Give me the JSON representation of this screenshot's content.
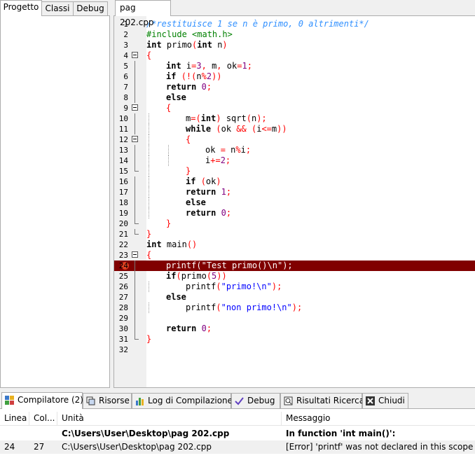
{
  "left_panel": {
    "tabs": [
      {
        "label": "Progetto",
        "active": true
      },
      {
        "label": "Classi",
        "active": false
      },
      {
        "label": "Debug",
        "active": false
      }
    ]
  },
  "editor": {
    "tab_label": "pag 202.cpp",
    "error_line": 24,
    "lines": [
      {
        "n": "1",
        "fold": "",
        "indent": 0,
        "tokens": [
          [
            "cmt",
            "/*restituisce 1 se n è primo, 0 altrimenti*/"
          ]
        ]
      },
      {
        "n": "2",
        "fold": "",
        "indent": 0,
        "tokens": [
          [
            "pre",
            "#include <math.h>"
          ]
        ]
      },
      {
        "n": "3",
        "fold": "",
        "indent": 0,
        "tokens": [
          [
            "kw",
            "int"
          ],
          [
            "id",
            " primo"
          ],
          [
            "sym",
            "("
          ],
          [
            "kw",
            "int"
          ],
          [
            "id",
            " n"
          ],
          [
            "sym",
            ")"
          ]
        ]
      },
      {
        "n": "4",
        "fold": "open",
        "indent": 0,
        "tokens": [
          [
            "sym",
            "{"
          ]
        ]
      },
      {
        "n": "5",
        "fold": "line",
        "indent": 1,
        "tokens": [
          [
            "kw",
            "int"
          ],
          [
            "id",
            " i"
          ],
          [
            "sym",
            "="
          ],
          [
            "num",
            "3"
          ],
          [
            "sym",
            ","
          ],
          [
            "id",
            " m"
          ],
          [
            "sym",
            ","
          ],
          [
            "id",
            " ok"
          ],
          [
            "sym",
            "="
          ],
          [
            "num",
            "1"
          ],
          [
            "sym",
            ";"
          ]
        ]
      },
      {
        "n": "6",
        "fold": "line",
        "indent": 1,
        "tokens": [
          [
            "kw",
            "if"
          ],
          [
            "id",
            " "
          ],
          [
            "sym",
            "(!("
          ],
          [
            "id",
            "n"
          ],
          [
            "sym",
            "%"
          ],
          [
            "num",
            "2"
          ],
          [
            "sym",
            "))"
          ]
        ]
      },
      {
        "n": "7",
        "fold": "line",
        "indent": 1,
        "tokens": [
          [
            "kw",
            "return"
          ],
          [
            "id",
            " "
          ],
          [
            "num",
            "0"
          ],
          [
            "sym",
            ";"
          ]
        ]
      },
      {
        "n": "8",
        "fold": "line",
        "indent": 1,
        "tokens": [
          [
            "kw",
            "else"
          ]
        ]
      },
      {
        "n": "9",
        "fold": "open",
        "indent": 1,
        "tokens": [
          [
            "sym",
            "{"
          ]
        ]
      },
      {
        "n": "10",
        "fold": "line",
        "indent": 2,
        "guides": [
          1
        ],
        "tokens": [
          [
            "id",
            "m"
          ],
          [
            "sym",
            "=("
          ],
          [
            "kw",
            "int"
          ],
          [
            "sym",
            ")"
          ],
          [
            "id",
            " sqrt"
          ],
          [
            "sym",
            "("
          ],
          [
            "id",
            "n"
          ],
          [
            "sym",
            ");"
          ]
        ]
      },
      {
        "n": "11",
        "fold": "line",
        "indent": 2,
        "guides": [
          1
        ],
        "tokens": [
          [
            "kw",
            "while"
          ],
          [
            "id",
            " "
          ],
          [
            "sym",
            "("
          ],
          [
            "id",
            "ok "
          ],
          [
            "sym",
            "&&"
          ],
          [
            "id",
            " "
          ],
          [
            "sym",
            "("
          ],
          [
            "id",
            "i"
          ],
          [
            "sym",
            "<="
          ],
          [
            "id",
            "m"
          ],
          [
            "sym",
            "))"
          ]
        ]
      },
      {
        "n": "12",
        "fold": "open",
        "indent": 2,
        "guides": [
          1
        ],
        "tokens": [
          [
            "sym",
            "{"
          ]
        ]
      },
      {
        "n": "13",
        "fold": "line",
        "indent": 3,
        "guides": [
          1,
          2
        ],
        "tokens": [
          [
            "id",
            "ok "
          ],
          [
            "sym",
            "="
          ],
          [
            "id",
            " n"
          ],
          [
            "sym",
            "%"
          ],
          [
            "id",
            "i"
          ],
          [
            "sym",
            ";"
          ]
        ]
      },
      {
        "n": "14",
        "fold": "line",
        "indent": 3,
        "guides": [
          1,
          2
        ],
        "tokens": [
          [
            "id",
            "i"
          ],
          [
            "sym",
            "+="
          ],
          [
            "num",
            "2"
          ],
          [
            "sym",
            ";"
          ]
        ]
      },
      {
        "n": "15",
        "fold": "end",
        "indent": 2,
        "guides": [
          1
        ],
        "tokens": [
          [
            "sym",
            "}"
          ]
        ]
      },
      {
        "n": "16",
        "fold": "line",
        "indent": 2,
        "guides": [
          1
        ],
        "tokens": [
          [
            "kw",
            "if"
          ],
          [
            "id",
            " "
          ],
          [
            "sym",
            "("
          ],
          [
            "id",
            "ok"
          ],
          [
            "sym",
            ")"
          ]
        ]
      },
      {
        "n": "17",
        "fold": "line",
        "indent": 2,
        "guides": [
          1
        ],
        "tokens": [
          [
            "kw",
            "return"
          ],
          [
            "id",
            " "
          ],
          [
            "num",
            "1"
          ],
          [
            "sym",
            ";"
          ]
        ]
      },
      {
        "n": "18",
        "fold": "line",
        "indent": 2,
        "guides": [
          1
        ],
        "tokens": [
          [
            "kw",
            "else"
          ]
        ]
      },
      {
        "n": "19",
        "fold": "line",
        "indent": 2,
        "guides": [
          1
        ],
        "tokens": [
          [
            "kw",
            "return"
          ],
          [
            "id",
            " "
          ],
          [
            "num",
            "0"
          ],
          [
            "sym",
            ";"
          ]
        ]
      },
      {
        "n": "20",
        "fold": "end",
        "indent": 1,
        "tokens": [
          [
            "sym",
            "}"
          ]
        ]
      },
      {
        "n": "21",
        "fold": "end",
        "indent": 0,
        "tokens": [
          [
            "sym",
            "}"
          ]
        ]
      },
      {
        "n": "22",
        "fold": "",
        "indent": 0,
        "tokens": [
          [
            "kw",
            "int"
          ],
          [
            "id",
            " main"
          ],
          [
            "sym",
            "()"
          ]
        ]
      },
      {
        "n": "23",
        "fold": "open",
        "indent": 0,
        "tokens": [
          [
            "sym",
            "{"
          ]
        ]
      },
      {
        "n": "24",
        "fold": "line",
        "indent": 1,
        "error": true,
        "tokens": [
          [
            "id",
            "printf"
          ],
          [
            "sym",
            "("
          ],
          [
            "str",
            "\"Test primo()\\n\""
          ],
          [
            "sym",
            ");"
          ]
        ]
      },
      {
        "n": "25",
        "fold": "line",
        "indent": 1,
        "tokens": [
          [
            "kw",
            "if"
          ],
          [
            "sym",
            "("
          ],
          [
            "id",
            "primo"
          ],
          [
            "sym",
            "("
          ],
          [
            "num",
            "5"
          ],
          [
            "sym",
            "))"
          ]
        ]
      },
      {
        "n": "26",
        "fold": "line",
        "indent": 2,
        "guides": [
          1
        ],
        "tokens": [
          [
            "id",
            "printf"
          ],
          [
            "sym",
            "("
          ],
          [
            "str",
            "\"primo!\\n\""
          ],
          [
            "sym",
            ");"
          ]
        ]
      },
      {
        "n": "27",
        "fold": "line",
        "indent": 1,
        "tokens": [
          [
            "kw",
            "else"
          ]
        ]
      },
      {
        "n": "28",
        "fold": "line",
        "indent": 2,
        "guides": [
          1
        ],
        "tokens": [
          [
            "id",
            "printf"
          ],
          [
            "sym",
            "("
          ],
          [
            "str",
            "\"non primo!\\n\""
          ],
          [
            "sym",
            ");"
          ]
        ]
      },
      {
        "n": "29",
        "fold": "line",
        "indent": 1,
        "tokens": []
      },
      {
        "n": "30",
        "fold": "line",
        "indent": 1,
        "tokens": [
          [
            "kw",
            "return"
          ],
          [
            "id",
            " "
          ],
          [
            "num",
            "0"
          ],
          [
            "sym",
            ";"
          ]
        ]
      },
      {
        "n": "31",
        "fold": "end",
        "indent": 0,
        "tokens": [
          [
            "sym",
            "}"
          ]
        ]
      },
      {
        "n": "32",
        "fold": "",
        "indent": 0,
        "tokens": []
      }
    ]
  },
  "bottom_panel": {
    "tabs": [
      {
        "label": "Compilatore (2)",
        "icon": "compiler-grid-icon",
        "active": true
      },
      {
        "label": "Risorse",
        "icon": "resources-icon",
        "active": false
      },
      {
        "label": "Log di Compilazione",
        "icon": "bar-chart-icon",
        "active": false
      },
      {
        "label": "Debug",
        "icon": "checkmark-icon",
        "active": false
      },
      {
        "label": "Risultati Ricerca",
        "icon": "search-results-icon",
        "active": false
      },
      {
        "label": "Chiudi",
        "icon": "close-icon",
        "active": false
      }
    ],
    "columns": [
      "Linea",
      "Col...",
      "Unità",
      "Messaggio"
    ],
    "rows": [
      {
        "linea": "",
        "col": "",
        "unita": "C:\\Users\\User\\Desktop\\pag 202.cpp",
        "messaggio": "In function 'int main()':",
        "bold": true,
        "selected": false
      },
      {
        "linea": "24",
        "col": "27",
        "unita": "C:\\Users\\User\\Desktop\\pag 202.cpp",
        "messaggio": "[Error] 'printf' was not declared in this scope",
        "bold": false,
        "selected": true
      }
    ]
  }
}
